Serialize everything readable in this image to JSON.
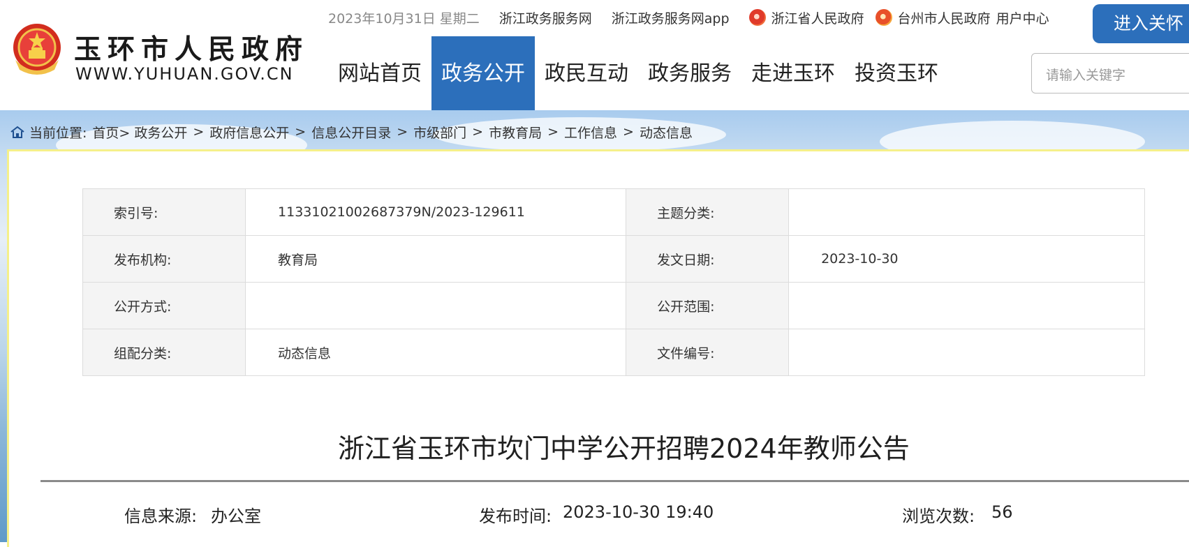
{
  "header": {
    "site_name": "玉环市人民政府",
    "site_url": "WWW.YUHUAN.GOV.CN",
    "date": "2023年10月31日 星期二",
    "links": [
      "浙江政务服务网",
      "浙江政务服务网app",
      "浙江省人民政府",
      "台州市人民政府",
      "用户中心"
    ],
    "care_button": "进入关怀",
    "nav": [
      "网站首页",
      "政务公开",
      "政民互动",
      "政务服务",
      "走进玉环",
      "投资玉环"
    ],
    "nav_active": "政务公开",
    "search_placeholder": "请输入关键字"
  },
  "breadcrumb": {
    "label": "当前位置:",
    "items": [
      "首页>",
      "政务公开",
      "政府信息公开",
      "信息公开目录",
      "市级部门",
      "市教育局",
      "工作信息",
      "动态信息"
    ],
    "separator": ">"
  },
  "meta": {
    "rows": [
      [
        "索引号:",
        "11331021002687379N/2023-129611",
        "主题分类:",
        ""
      ],
      [
        "发布机构:",
        "教育局",
        "发文日期:",
        "2023-10-30"
      ],
      [
        "公开方式:",
        "",
        "公开范围:",
        ""
      ],
      [
        "组配分类:",
        "动态信息",
        "文件编号:",
        ""
      ]
    ]
  },
  "article": {
    "title": "浙江省玉环市坎门中学公开招聘2024年教师公告",
    "source_label": "信息来源:",
    "source_value": "办公室",
    "time_label": "发布时间:",
    "time_value": "2023-10-30 19:40",
    "views_label": "浏览次数:",
    "views_value": "56"
  },
  "colors": {
    "primary_blue": "#2c6fbb",
    "content_border": "#f5f08a"
  }
}
